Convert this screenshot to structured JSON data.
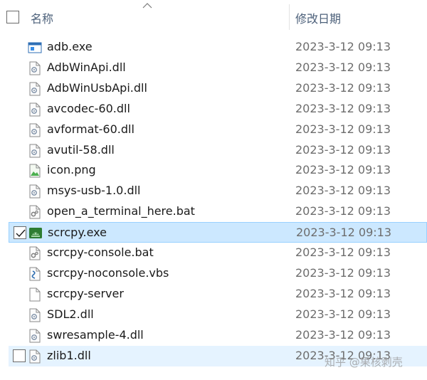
{
  "header": {
    "name_label": "名称",
    "date_label": "修改日期"
  },
  "colors": {
    "selected_bg": "#cce8ff",
    "selected_border": "#99d1ff",
    "hover_bg": "#e5f3ff",
    "header_text": "#4c607a",
    "date_text": "#6d6d6d"
  },
  "files": [
    {
      "name": "adb.exe",
      "date": "2023-3-12 09:13",
      "icon": "exe-window-icon"
    },
    {
      "name": "AdbWinApi.dll",
      "date": "2023-3-12 09:13",
      "icon": "dll-file-icon"
    },
    {
      "name": "AdbWinUsbApi.dll",
      "date": "2023-3-12 09:13",
      "icon": "dll-file-icon"
    },
    {
      "name": "avcodec-60.dll",
      "date": "2023-3-12 09:13",
      "icon": "dll-file-icon"
    },
    {
      "name": "avformat-60.dll",
      "date": "2023-3-12 09:13",
      "icon": "dll-file-icon"
    },
    {
      "name": "avutil-58.dll",
      "date": "2023-3-12 09:13",
      "icon": "dll-file-icon"
    },
    {
      "name": "icon.png",
      "date": "2023-3-12 09:13",
      "icon": "image-file-icon"
    },
    {
      "name": "msys-usb-1.0.dll",
      "date": "2023-3-12 09:13",
      "icon": "dll-file-icon"
    },
    {
      "name": "open_a_terminal_here.bat",
      "date": "2023-3-12 09:13",
      "icon": "bat-file-icon"
    },
    {
      "name": "scrcpy.exe",
      "date": "2023-3-12 09:13",
      "icon": "android-app-icon",
      "selected": true,
      "checked": true
    },
    {
      "name": "scrcpy-console.bat",
      "date": "2023-3-12 09:13",
      "icon": "bat-file-icon"
    },
    {
      "name": "scrcpy-noconsole.vbs",
      "date": "2023-3-12 09:13",
      "icon": "vbs-script-icon"
    },
    {
      "name": "scrcpy-server",
      "date": "2023-3-12 09:13",
      "icon": "blank-file-icon"
    },
    {
      "name": "SDL2.dll",
      "date": "2023-3-12 09:13",
      "icon": "dll-file-icon"
    },
    {
      "name": "swresample-4.dll",
      "date": "2023-3-12 09:13",
      "icon": "dll-file-icon"
    },
    {
      "name": "zlib1.dll",
      "date": "2023-3-12 09:13",
      "icon": "dll-file-icon",
      "hovered": true,
      "checked": false
    }
  ],
  "watermark": "知乎 @果核剥壳"
}
